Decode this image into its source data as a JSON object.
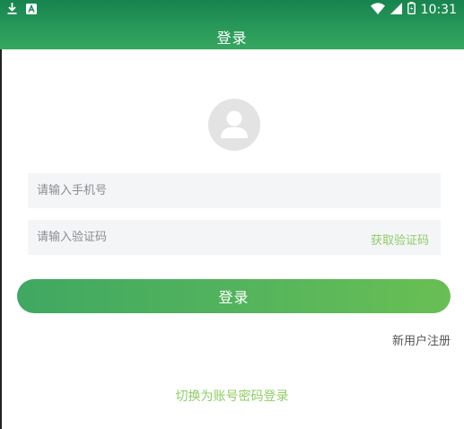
{
  "status_bar": {
    "time": "10:31",
    "left_icons": [
      "download-icon",
      "notification-a-icon"
    ],
    "right_icons": [
      "wifi-icon",
      "signal-icon",
      "battery-icon"
    ]
  },
  "header": {
    "title": "登录"
  },
  "form": {
    "phone": {
      "placeholder": "请输入手机号",
      "value": ""
    },
    "code": {
      "placeholder": "请输入验证码",
      "value": "",
      "get_code_label": "获取验证码"
    },
    "login_label": "登录"
  },
  "links": {
    "register": "新用户注册",
    "switch_mode": "切换为账号密码登录"
  },
  "colors": {
    "header": "#17834f",
    "accent_light": "#8fcc66",
    "input_bg": "#f4f5f7",
    "avatar_bg": "#e3e3e3"
  }
}
